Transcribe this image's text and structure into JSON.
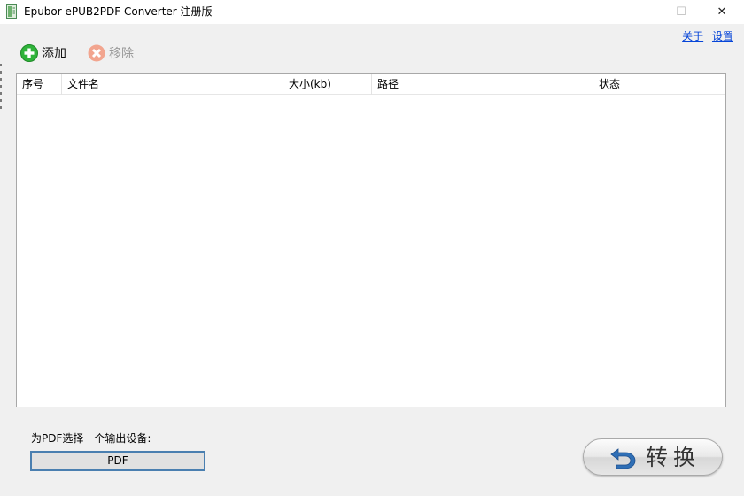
{
  "window": {
    "title": "Epubor ePUB2PDF Converter 注册版",
    "minimize_glyph": "—",
    "maximize_glyph": "☐",
    "close_glyph": "✕"
  },
  "links": {
    "about": "关于",
    "settings": "设置"
  },
  "toolbar": {
    "add_label": "添加",
    "add_icon": "plus-circle-icon",
    "remove_label": "移除",
    "remove_icon": "x-circle-icon",
    "remove_enabled": false
  },
  "file_list": {
    "columns": [
      "序号",
      "文件名",
      "大小(kb)",
      "路径",
      "状态"
    ],
    "rows": []
  },
  "output": {
    "device_label": "为PDF选择一个输出设备:",
    "device_value": "PDF"
  },
  "convert": {
    "label": "转换",
    "icon": "undo-arrow-icon"
  },
  "colors": {
    "add_icon": "#2fb33a",
    "remove_icon": "#f2a58f",
    "convert_icon": "#2f6fb6",
    "link": "#0645d8",
    "select_border": "#4a7fb0"
  }
}
